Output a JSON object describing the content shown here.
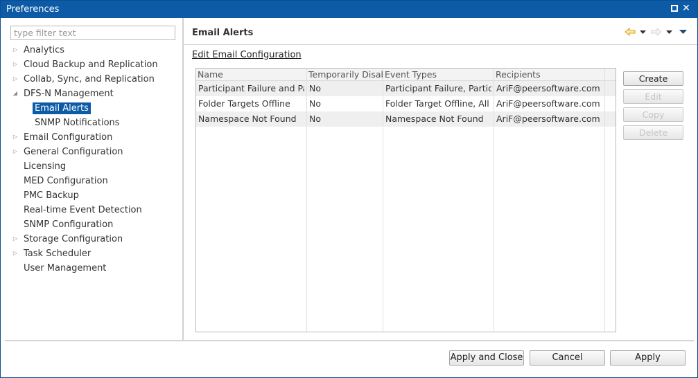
{
  "window": {
    "title": "Preferences",
    "maximize_label": "",
    "close_label": "✕"
  },
  "sidebar": {
    "filter_placeholder": "type filter text",
    "items": [
      {
        "label": "Analytics",
        "expandable": true,
        "level": 0
      },
      {
        "label": "Cloud Backup and Replication",
        "expandable": true,
        "level": 0
      },
      {
        "label": "Collab, Sync, and Replication",
        "expandable": true,
        "level": 0
      },
      {
        "label": "DFS-N Management",
        "expandable": true,
        "expanded": true,
        "level": 0
      },
      {
        "label": "Email Alerts",
        "level": 1,
        "selected": true
      },
      {
        "label": "SNMP Notifications",
        "level": 1
      },
      {
        "label": "Email Configuration",
        "expandable": true,
        "level": 0
      },
      {
        "label": "General Configuration",
        "expandable": true,
        "level": 0
      },
      {
        "label": "Licensing",
        "level": 0
      },
      {
        "label": "MED Configuration",
        "level": 0
      },
      {
        "label": "PMC Backup",
        "level": 0
      },
      {
        "label": "Real-time Event Detection",
        "level": 0
      },
      {
        "label": "SNMP Configuration",
        "level": 0
      },
      {
        "label": "Storage Configuration",
        "expandable": true,
        "level": 0
      },
      {
        "label": "Task Scheduler",
        "expandable": true,
        "level": 0
      },
      {
        "label": "User Management",
        "level": 0
      }
    ]
  },
  "main": {
    "title": "Email Alerts",
    "link": "Edit Email Configuration",
    "nav_icons": [
      "back-arrow-icon",
      "forward-arrow-icon",
      "view-menu-icon"
    ],
    "table": {
      "columns": [
        "Name",
        "Temporarily Disabled",
        "Event Types",
        "Recipients"
      ],
      "rows": [
        [
          "Participant Failure and Participant Recovery",
          "No",
          "Participant Failure, Participant Recovery",
          "AriF@peersoftware.com"
        ],
        [
          "Folder Targets Offline",
          "No",
          "Folder Target Offline, All Folder Targets Offline",
          "AriF@peersoftware.com"
        ],
        [
          "Namespace Not Found",
          "No",
          "Namespace Not Found",
          "AriF@peersoftware.com"
        ]
      ]
    },
    "buttons": {
      "create": "Create",
      "edit": "Edit",
      "copy": "Copy",
      "delete": "Delete"
    }
  },
  "footer": {
    "apply_close": "Apply and Close",
    "cancel": "Cancel",
    "apply": "Apply"
  },
  "colors": {
    "accent": "#0d5ba6"
  }
}
